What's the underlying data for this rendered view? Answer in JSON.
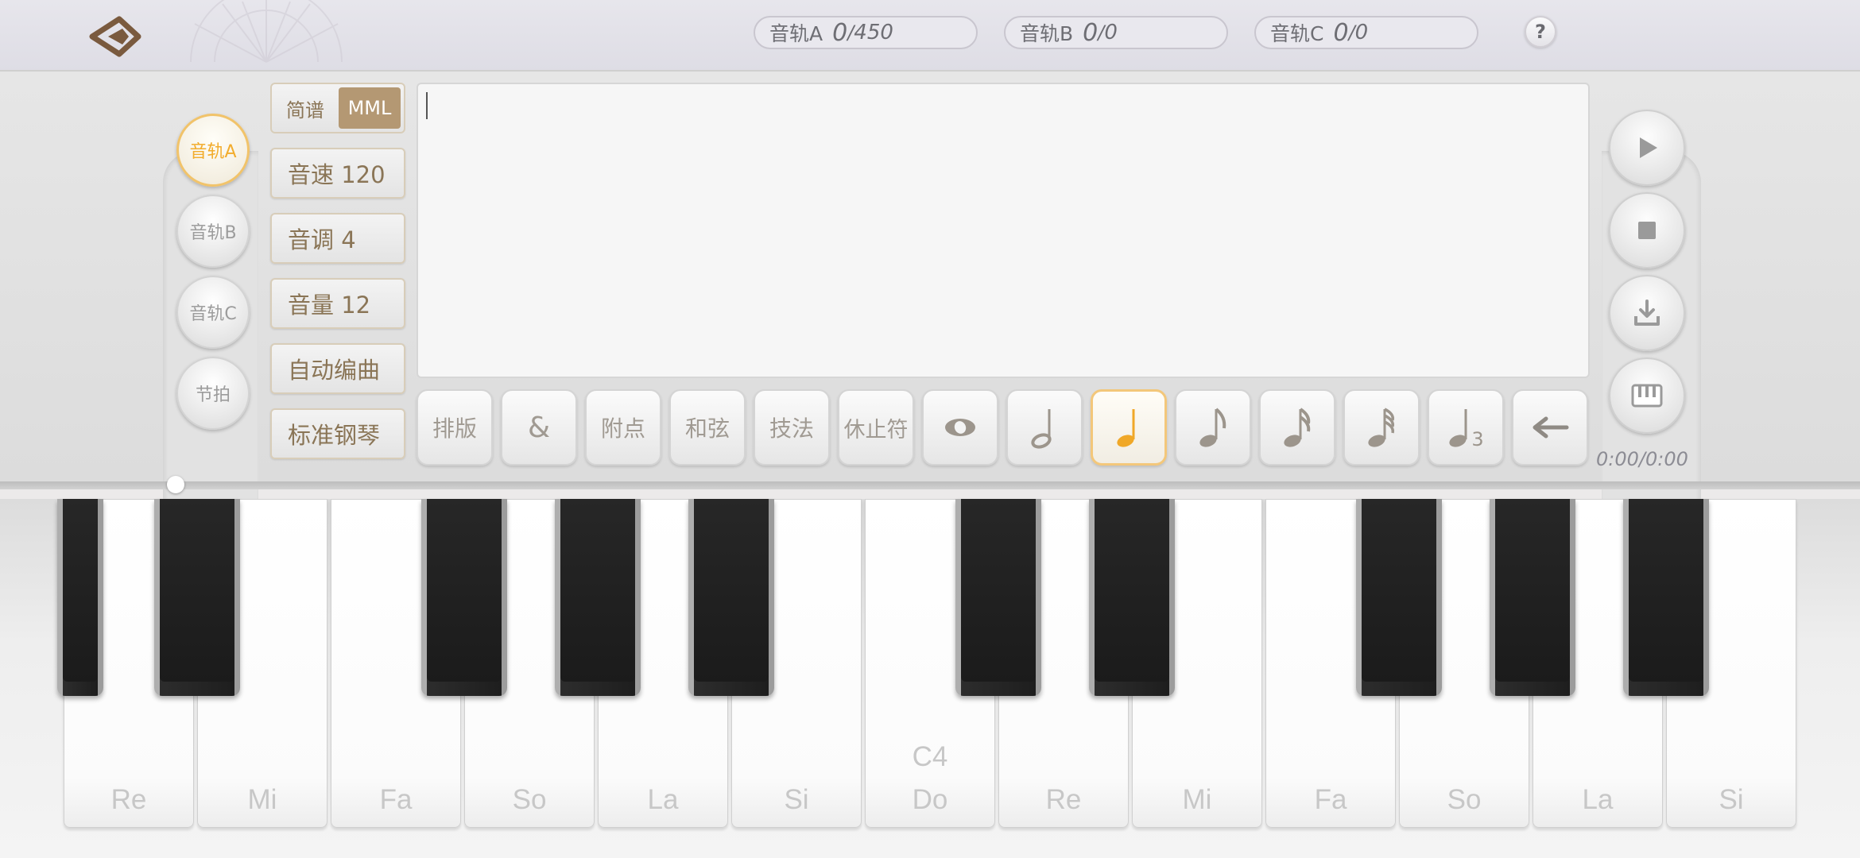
{
  "header": {
    "counters": [
      {
        "label": "音轨A",
        "value": "0",
        "sep": "/",
        "max": "450"
      },
      {
        "label": "音轨B",
        "value": "0",
        "sep": "/",
        "max": "0"
      },
      {
        "label": "音轨C",
        "value": "0",
        "sep": "/",
        "max": "0"
      }
    ],
    "help_label": "?"
  },
  "tracks": [
    {
      "label": "音轨A",
      "active": true
    },
    {
      "label": "音轨B",
      "active": false
    },
    {
      "label": "音轨C",
      "active": false
    },
    {
      "label": "节拍",
      "active": false
    }
  ],
  "mode": {
    "jianpu": "简谱",
    "mml": "MML",
    "selected": "MML"
  },
  "settings": {
    "tempo": "音速 120",
    "key": "音调 4",
    "volume": "音量 12",
    "auto_compose": "自动编曲",
    "instrument": "标准钢琴"
  },
  "editor": {
    "text": ""
  },
  "toolbar": {
    "layout": "排版",
    "ampersand": "&",
    "dot": "附点",
    "chord": "和弦",
    "technique": "技法",
    "rest": "休止符",
    "triplet_sub": "3",
    "selected_note": "quarter-note"
  },
  "playback": {
    "time": "0:00/0:00"
  },
  "keyboard": {
    "white_keys": [
      "Re",
      "Mi",
      "Fa",
      "So",
      "La",
      "Si",
      "Do",
      "Re",
      "Mi",
      "Fa",
      "So",
      "La",
      "Si"
    ],
    "middle_c_label": "C4",
    "accent_color": "#f2ac2c",
    "mml_color": "#b49873"
  }
}
